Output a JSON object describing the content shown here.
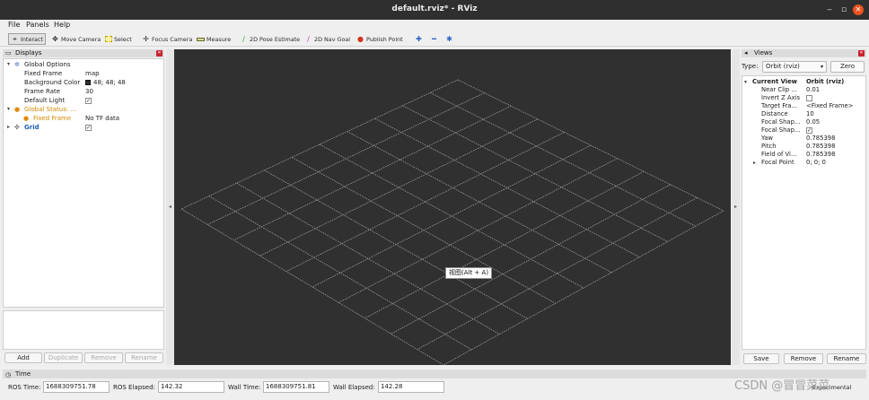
{
  "window": {
    "title": "default.rviz* - RViz"
  },
  "menu": [
    "File",
    "Panels",
    "Help"
  ],
  "toolbar": {
    "tools": [
      {
        "label": "Interact",
        "icon": "interact-icon",
        "active": true
      },
      {
        "label": "Move Camera",
        "icon": "move-camera-icon"
      },
      {
        "label": "Select",
        "icon": "select-icon"
      },
      {
        "label": "Focus Camera",
        "icon": "focus-camera-icon"
      },
      {
        "label": "Measure",
        "icon": "measure-icon"
      },
      {
        "label": "2D Pose Estimate",
        "icon": "pose-estimate-icon"
      },
      {
        "label": "2D Nav Goal",
        "icon": "nav-goal-icon"
      },
      {
        "label": "Publish Point",
        "icon": "publish-point-icon"
      }
    ]
  },
  "displays": {
    "title": "Displays",
    "rows": [
      {
        "name": "Global Options",
        "value": "",
        "level": 0
      },
      {
        "name": "Fixed Frame",
        "value": "map",
        "level": 1
      },
      {
        "name": "Background Color",
        "value": "48; 48; 48",
        "level": 1
      },
      {
        "name": "Frame Rate",
        "value": "30",
        "level": 1
      },
      {
        "name": "Default Light",
        "value": "",
        "level": 1
      },
      {
        "name": "Global Status: ...",
        "value": "",
        "level": 0
      },
      {
        "name": "Fixed Frame",
        "value": "No TF data",
        "level": 1
      },
      {
        "name": "Grid",
        "value": "",
        "level": 0
      }
    ],
    "buttons": {
      "add": "Add",
      "duplicate": "Duplicate",
      "remove": "Remove",
      "rename": "Rename"
    }
  },
  "viewport": {
    "tooltip": "视图(Alt + A)",
    "background": "#303030",
    "grid_color": "#a0a0a0",
    "grid_cells": 10
  },
  "views": {
    "title": "Views",
    "type_label": "Type:",
    "type_value": "Orbit (rviz)",
    "zero_label": "Zero",
    "rows": [
      {
        "name": "Current View",
        "value": "Orbit (rviz)"
      },
      {
        "name": "Near Clip ...",
        "value": "0.01"
      },
      {
        "name": "Invert Z Axis",
        "value": ""
      },
      {
        "name": "Target Fra...",
        "value": "<Fixed Frame>"
      },
      {
        "name": "Distance",
        "value": "10"
      },
      {
        "name": "Focal Shap...",
        "value": "0.05"
      },
      {
        "name": "Focal Shap...",
        "value": ""
      },
      {
        "name": "Yaw",
        "value": "0.785398"
      },
      {
        "name": "Pitch",
        "value": "0.785398"
      },
      {
        "name": "Field of Vi...",
        "value": "0.785398"
      },
      {
        "name": "Focal Point",
        "value": "0; 0; 0"
      }
    ],
    "buttons": {
      "save": "Save",
      "remove": "Remove",
      "rename": "Rename"
    }
  },
  "time": {
    "title": "Time",
    "ros_time_label": "ROS Time:",
    "ros_time": "1688309751.78",
    "ros_elapsed_label": "ROS Elapsed:",
    "ros_elapsed": "142.32",
    "wall_time_label": "Wall Time:",
    "wall_time": "1688309751.81",
    "wall_elapsed_label": "Wall Elapsed:",
    "wall_elapsed": "142.28",
    "experimental": "Experimental"
  },
  "watermark": "CSDN @冒冒菜菜",
  "colors": {
    "titlebar": "#2f2f2f",
    "close_button": "#e95420",
    "status_warning": "#e08a00",
    "grid_display": "#1a5fb4"
  }
}
